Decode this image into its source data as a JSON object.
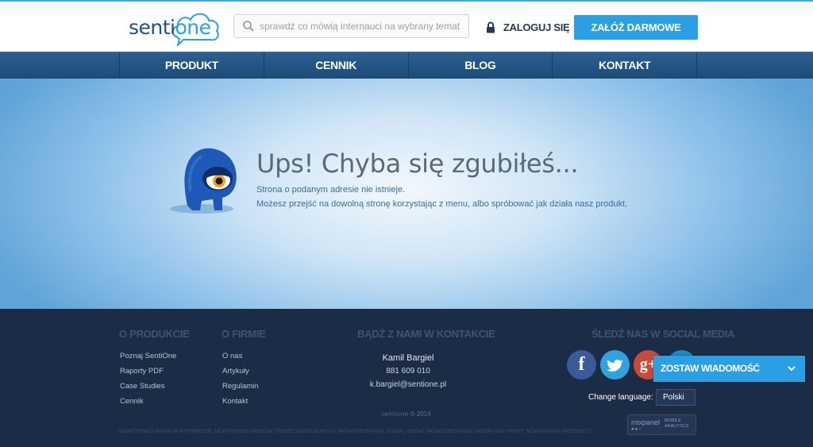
{
  "header": {
    "logo": {
      "part1": "senti",
      "part2": "one"
    },
    "search": {
      "placeholder": "sprawdź co mówią internauci na wybrany temat",
      "value": ""
    },
    "login_label": "ZALOGUJ SIĘ",
    "signup_label": "ZAŁÓŻ DARMOWE KONTO"
  },
  "nav": {
    "items": [
      {
        "label": "PRODUKT"
      },
      {
        "label": "CENNIK"
      },
      {
        "label": "BLOG"
      },
      {
        "label": "KONTAKT"
      }
    ]
  },
  "hero": {
    "title": "Ups! Chyba się zgubiłeś...",
    "line1": "Strona o podanym adresie nie istnieje.",
    "line2": "Możesz przejść na dowolną stronę korzystając z menu, albo spróbować jak działa nasz produkt."
  },
  "footer": {
    "product": {
      "heading": "O PRODUKCIE",
      "links": [
        "Poznaj SentiOne",
        "Raporty PDF",
        "Case Studies",
        "Cennik"
      ]
    },
    "company": {
      "heading": "O FIRMIE",
      "links": [
        "O nas",
        "Artykuły",
        "Regulamin",
        "Kontakt"
      ]
    },
    "contact": {
      "heading": "BĄDŹ Z NAMI W KONTAKCIE",
      "name": "Kamil Bargiel",
      "phone": "881 609 010",
      "email": "k.bargiel@sentione.pl"
    },
    "social": {
      "heading": "ŚLEDŹ NAS W SOCIAL MEDIA",
      "icons": [
        {
          "name": "facebook-icon",
          "glyph": "f",
          "color": "#3b5a99"
        },
        {
          "name": "twitter-icon",
          "color": "#2fa3df"
        },
        {
          "name": "google-plus-icon",
          "glyph": "g+",
          "color": "#c84a3a"
        },
        {
          "name": "linkedin-icon",
          "glyph": "in",
          "color": "#1d8dc6"
        }
      ]
    },
    "language": {
      "label": "Change language:",
      "value": "Polski"
    },
    "copyright": {
      "brand_part1": "senti",
      "brand_part2": "one",
      "text": "© 2014"
    },
    "seo_text": "MONITORING MARKI W INTERNECIE, MONITORING MEDIÓW SPOŁECZNOŚCIOWYCH, MONITOROWANIE SOCIAL MEDIA, MONITOROWANIE WIZERUNKU FIRMY, MONITORING INTERNETU",
    "mixpanel": {
      "brand": "mixpanel",
      "sub1": "MOBILE",
      "sub2": "ANALYTICS"
    }
  },
  "chat": {
    "label": "ZOSTAW WIADOMOŚĆ"
  },
  "colors": {
    "accent": "#2b9fe4",
    "nav": "#1d4b78",
    "footer": "#1d2c46"
  }
}
